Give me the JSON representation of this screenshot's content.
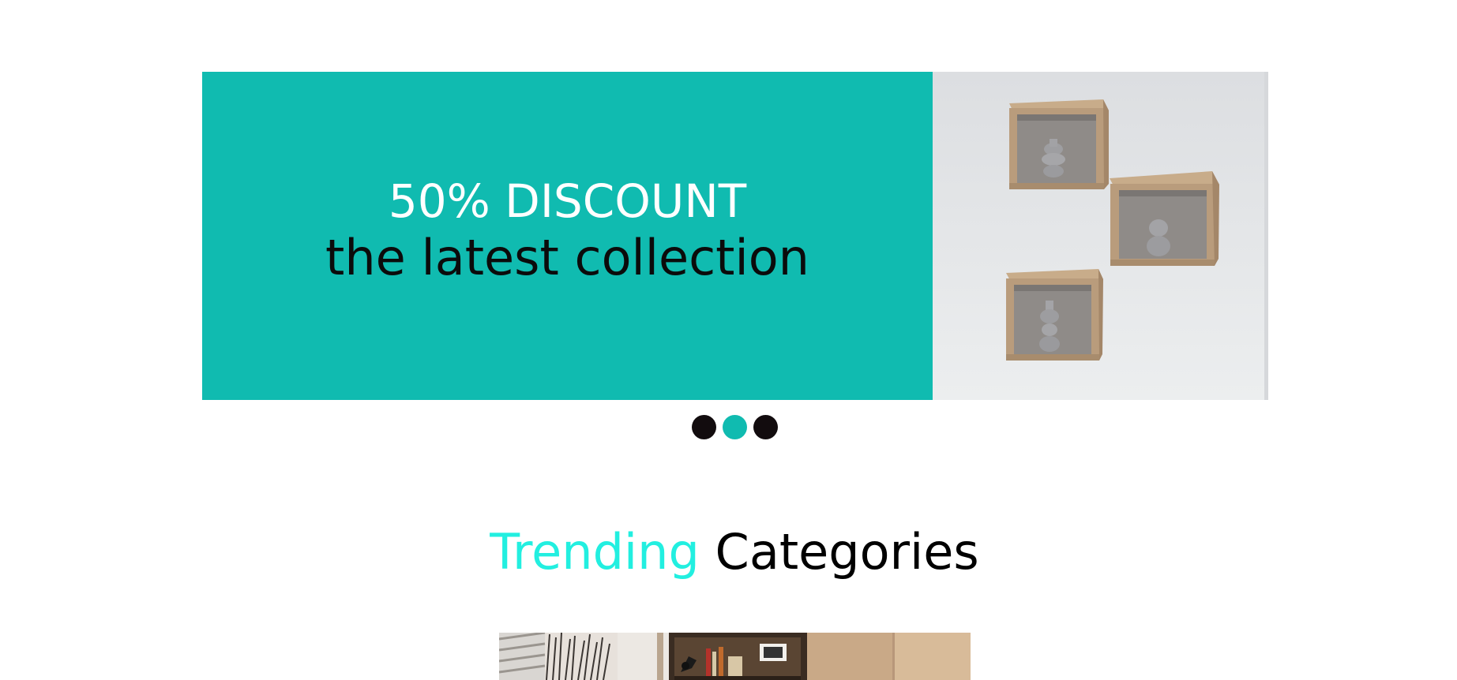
{
  "hero": {
    "line1": "50% DISCOUNT",
    "line2": "the latest collection",
    "promo_color": "#10bbb0",
    "image": "wall-cube-shelves-image"
  },
  "slider": {
    "dot_count": 3,
    "active_index": 1,
    "dot_color": "#120c0e",
    "active_color": "#10bbb0"
  },
  "section": {
    "title_accent": "Trending",
    "title_main": "Categories",
    "accent_color": "#22efe0"
  },
  "categories": {
    "first_image": "home-office-shelf-image"
  }
}
